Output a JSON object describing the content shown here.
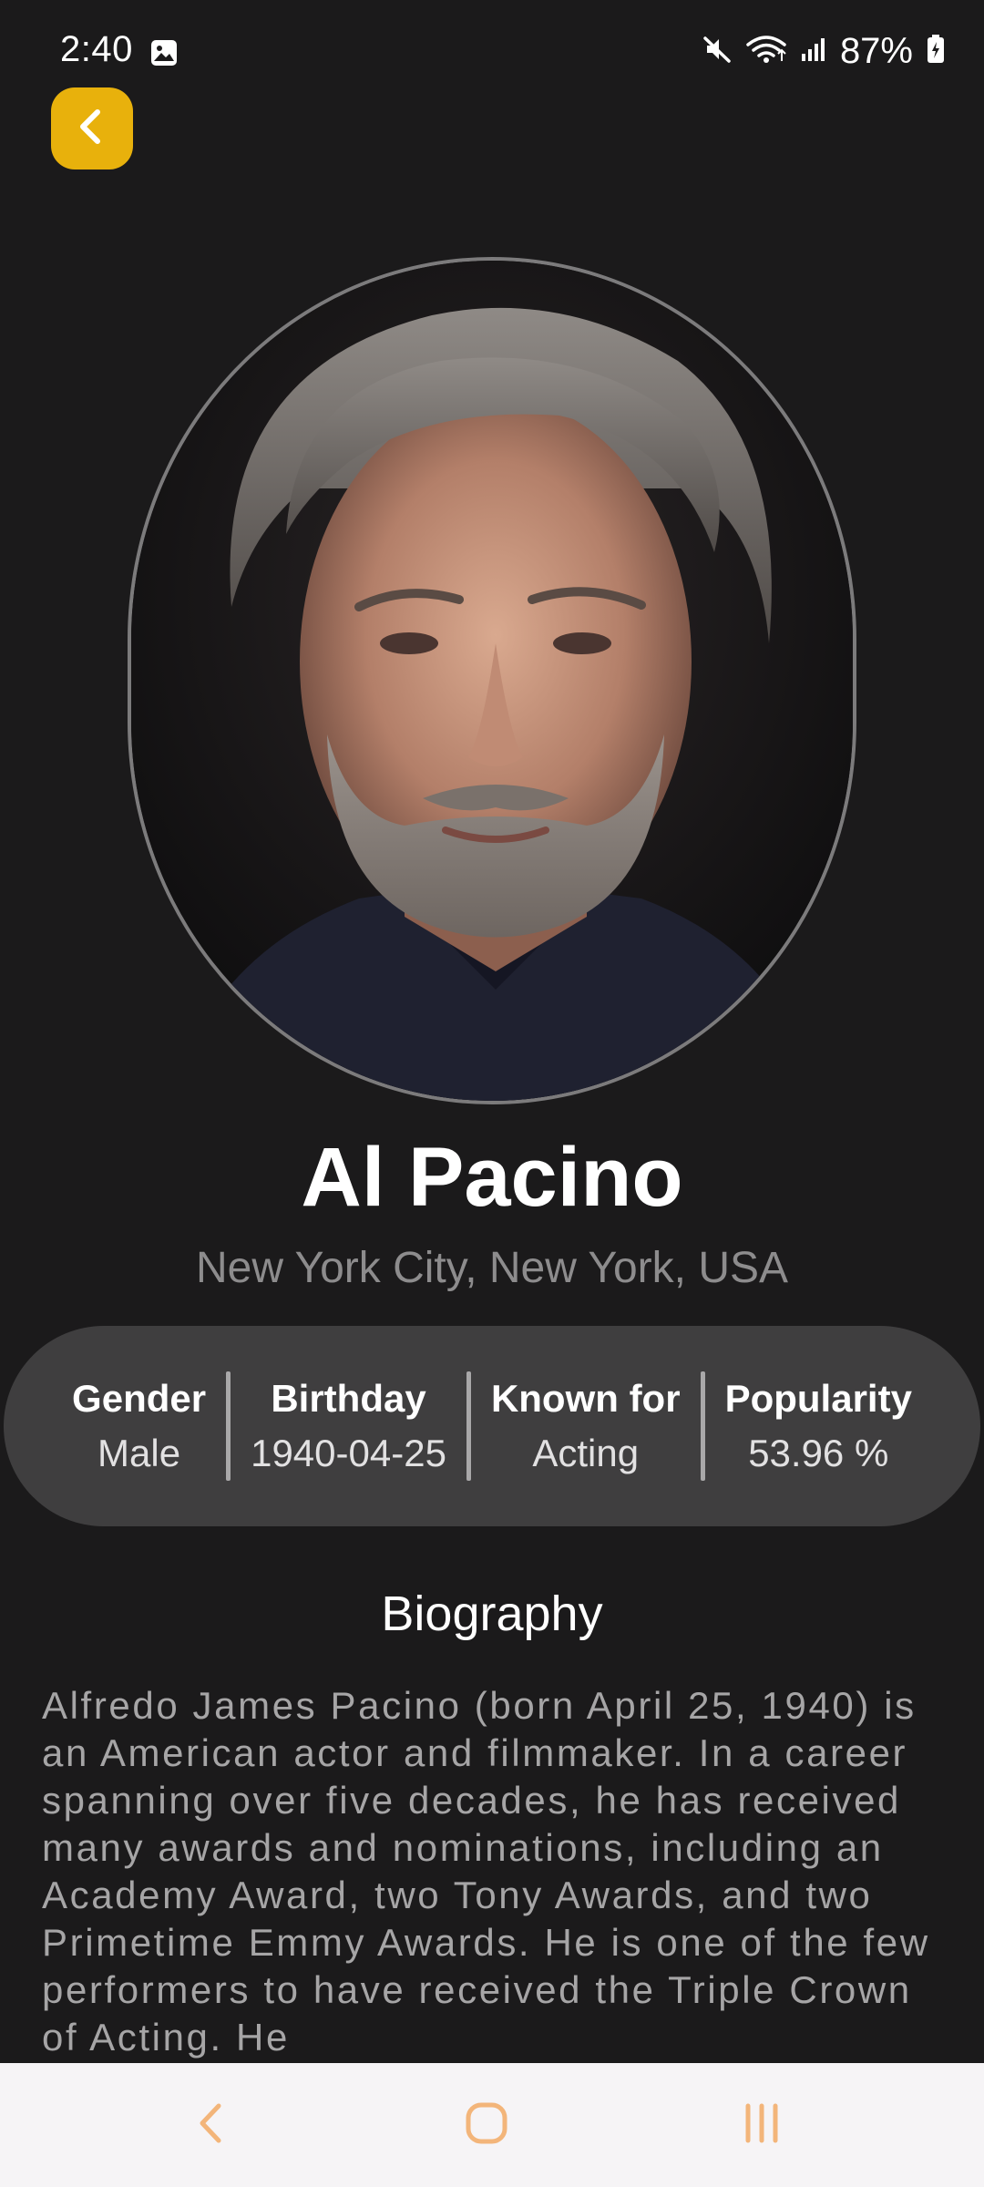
{
  "status_bar": {
    "time": "2:40",
    "battery": "87%",
    "icons": [
      "gallery-icon",
      "mute-icon",
      "wifi-icon",
      "signal-icon",
      "battery-icon"
    ]
  },
  "header": {
    "back_icon": "chevron-left-icon",
    "accent_color": "#e8b10c"
  },
  "person": {
    "name": "Al Pacino",
    "birthplace": "New York City, New York, USA"
  },
  "info": [
    {
      "label": "Gender",
      "value": "Male"
    },
    {
      "label": "Birthday",
      "value": "1940-04-25"
    },
    {
      "label": "Known for",
      "value": "Acting"
    },
    {
      "label": "Popularity",
      "value": "53.96 %"
    }
  ],
  "biography": {
    "title": "Biography",
    "text": "Alfredo James Pacino (born April 25, 1940) is an American actor and filmmaker. In a career spanning over five decades, he has received many awards and nominations, including an Academy Award, two Tony Awards, and two Primetime Emmy Awards. He is one of the few performers to have received the Triple Crown of Acting. He"
  },
  "nav_bar": {
    "icons": [
      "nav-back-icon",
      "nav-home-icon",
      "nav-recents-icon"
    ],
    "color": "#f3b57a"
  }
}
